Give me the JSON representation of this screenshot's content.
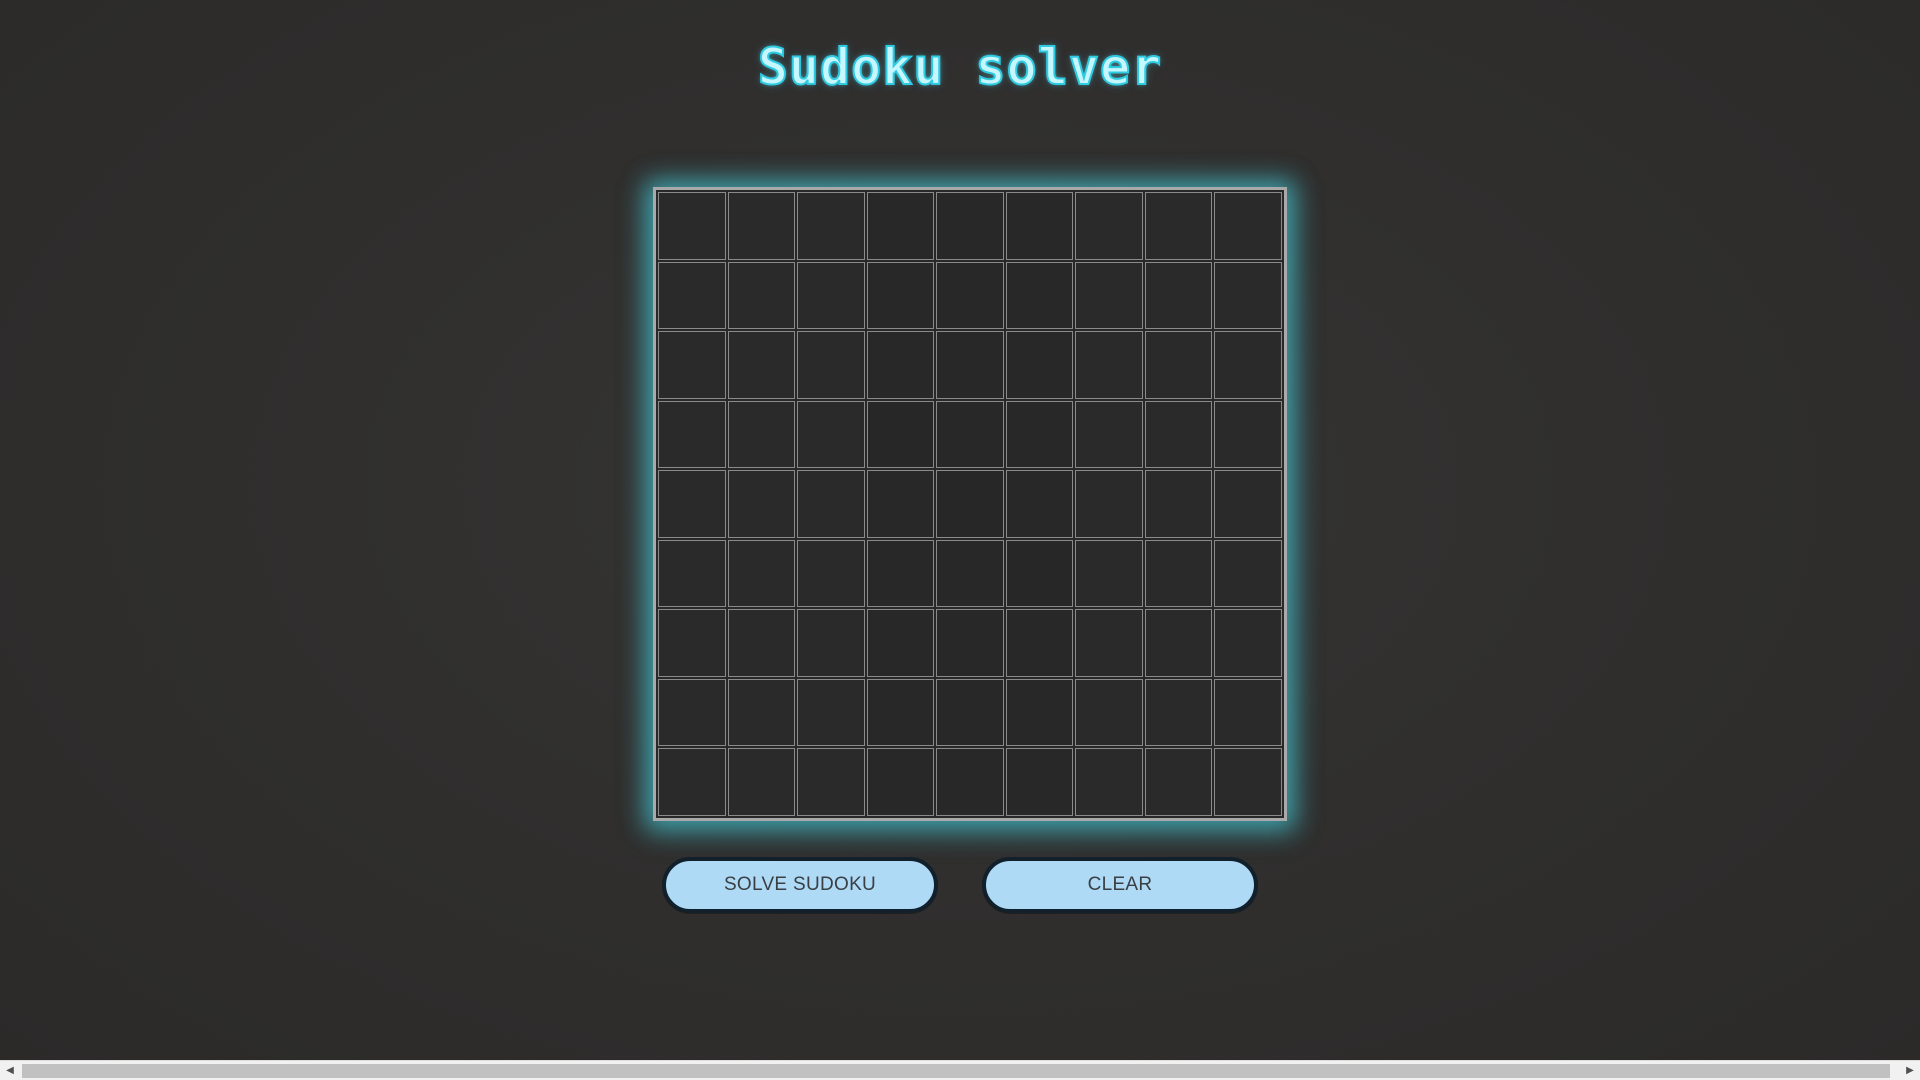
{
  "app": {
    "title": "Sudoku solver"
  },
  "board": {
    "rows": 9,
    "cols": 9,
    "cells": [
      [
        "",
        "",
        "",
        "",
        "",
        "",
        "",
        "",
        ""
      ],
      [
        "",
        "",
        "",
        "",
        "",
        "",
        "",
        "",
        ""
      ],
      [
        "",
        "",
        "",
        "",
        "",
        "",
        "",
        "",
        ""
      ],
      [
        "",
        "",
        "",
        "",
        "",
        "",
        "",
        "",
        ""
      ],
      [
        "",
        "",
        "",
        "",
        "",
        "",
        "",
        "",
        ""
      ],
      [
        "",
        "",
        "",
        "",
        "",
        "",
        "",
        "",
        ""
      ],
      [
        "",
        "",
        "",
        "",
        "",
        "",
        "",
        "",
        ""
      ],
      [
        "",
        "",
        "",
        "",
        "",
        "",
        "",
        "",
        ""
      ],
      [
        "",
        "",
        "",
        "",
        "",
        "",
        "",
        "",
        ""
      ]
    ]
  },
  "actions": {
    "solve_label": "SOLVE SUDOKU",
    "clear_label": "CLEAR"
  },
  "scrollbar": {
    "left_icon": "arrow-left-icon",
    "right_icon": "arrow-right-icon"
  },
  "colors": {
    "title_fill": "#c6f7ff",
    "title_glow": "#2ecbe3",
    "board_glow": "#46cddc",
    "button_bg": "#aedaf6",
    "button_border": "#12202b",
    "background": "#2f2e2d"
  }
}
